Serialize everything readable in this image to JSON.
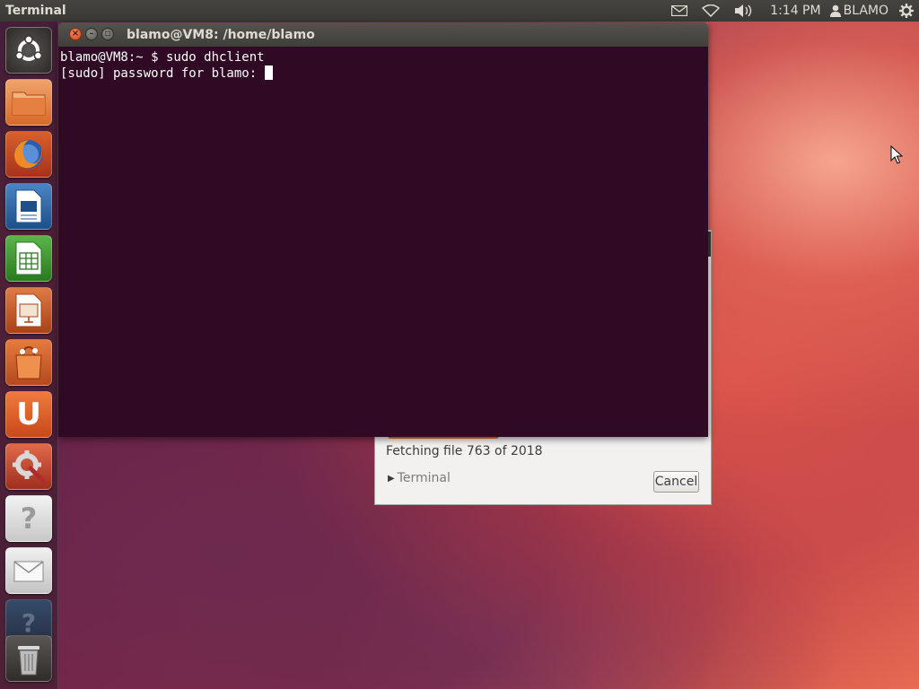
{
  "top_panel": {
    "app_title": "Terminal",
    "clock": "1:14 PM",
    "user": "BLAMO",
    "indicators": [
      "mail-icon",
      "network-wifi-icon",
      "volume-icon",
      "user-icon",
      "gear-icon"
    ]
  },
  "launcher": {
    "items": [
      {
        "name": "dash-home",
        "icon": "ubuntu-logo-icon"
      },
      {
        "name": "home-folder",
        "icon": "folder-icon"
      },
      {
        "name": "firefox",
        "icon": "firefox-icon"
      },
      {
        "name": "libreoffice-writer",
        "icon": "writer-icon"
      },
      {
        "name": "libreoffice-calc",
        "icon": "calc-icon"
      },
      {
        "name": "libreoffice-impress",
        "icon": "impress-icon"
      },
      {
        "name": "software-center",
        "icon": "shopping-bag-icon"
      },
      {
        "name": "ubuntu-one",
        "icon": "ubuntu-one-icon"
      },
      {
        "name": "system-settings",
        "icon": "settings-wrench-icon"
      },
      {
        "name": "help",
        "icon": "help-icon"
      },
      {
        "name": "mail",
        "icon": "envelope-icon"
      },
      {
        "name": "workspace-help",
        "icon": "help-icon"
      },
      {
        "name": "trash",
        "icon": "trash-icon"
      }
    ]
  },
  "terminal": {
    "title": "blamo@VM8: /home/blamo",
    "line1": "blamo@VM8:~ $ sudo dhclient",
    "line2": "[sudo] password for blamo: "
  },
  "dialog": {
    "status": "Fetching file 763 of 2018",
    "expander_label": "Terminal",
    "cancel_label": "Cancel",
    "progress_color": "#e8701f"
  },
  "colors": {
    "terminal_bg": "#300a24",
    "panel_bg": "#3a3935",
    "accent": "#dd4814"
  }
}
